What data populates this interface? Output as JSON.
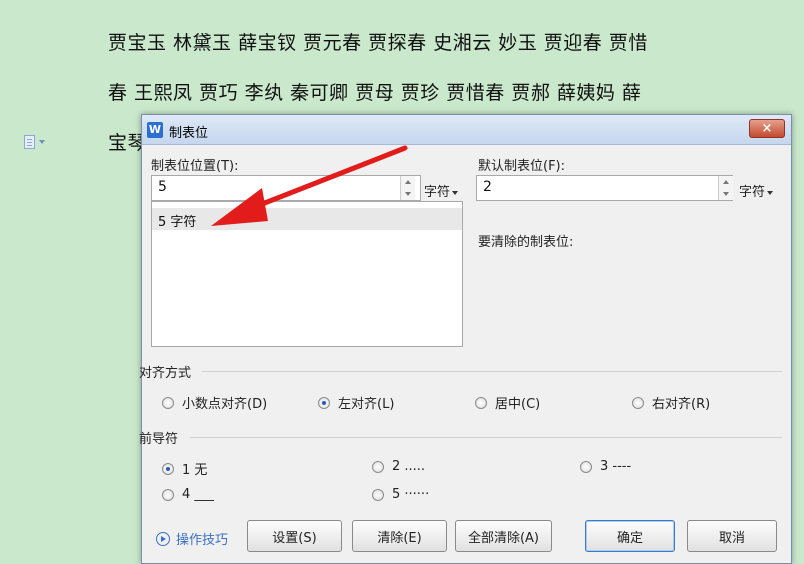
{
  "document": {
    "line1": "贾宝玉 林黛玉 薛宝钗 贾元春 贾探春 史湘云 妙玉 贾迎春 贾惜",
    "line2": "春 王熙凤 贾巧 李纨 秦可卿 贾母 贾珍 贾惜春 贾郝 薛姨妈 薛",
    "line3": "宝琴"
  },
  "dialog": {
    "app_icon_letter": "W",
    "title": "制表位",
    "close_label": "×",
    "tab_position_label": "制表位位置(T):",
    "tab_position_value": "5",
    "tab_position_unit": "字符",
    "default_tab_label": "默认制表位(F):",
    "default_tab_value": "2",
    "default_tab_unit": "字符",
    "tab_list": [
      "5 字符"
    ],
    "clear_label": "要清除的制表位:",
    "alignment_label": "对齐方式",
    "alignment_options": [
      {
        "label": "小数点对齐(D)",
        "selected": false
      },
      {
        "label": "左对齐(L)",
        "selected": true
      },
      {
        "label": "居中(C)",
        "selected": false
      },
      {
        "label": "右对齐(R)",
        "selected": false
      }
    ],
    "leader_label": "前导符",
    "leader_options": [
      {
        "label": "1 无",
        "selected": true
      },
      {
        "label": "2 .....",
        "selected": false
      },
      {
        "label": "3 ----",
        "selected": false
      },
      {
        "label": "4 ___",
        "selected": false
      },
      {
        "label": "5 ······",
        "selected": false
      }
    ],
    "help_link": "操作技巧",
    "buttons": {
      "set": "设置(S)",
      "clear": "清除(E)",
      "clear_all": "全部清除(A)",
      "ok": "确定",
      "cancel": "取消"
    }
  },
  "colors": {
    "page_background": "#c9e8cc",
    "annotation_arrow": "#e21b1b",
    "link": "#3c6fc4"
  }
}
